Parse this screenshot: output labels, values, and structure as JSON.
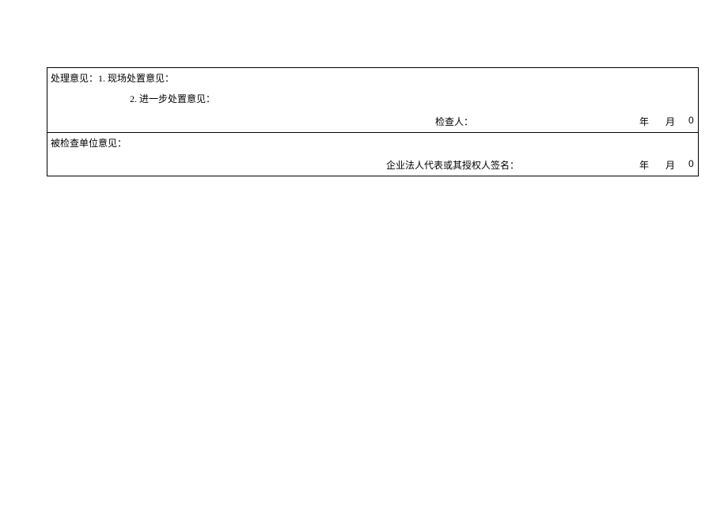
{
  "section1": {
    "header": "处理意见：1. 现场处置意见：",
    "item2": "2. 进一步处置意见：",
    "inspector": "检查人：",
    "year": "年",
    "month": "月",
    "zero": "0"
  },
  "section2": {
    "header": "被检查单位意见：",
    "rep": "企业法人代表或其授权人签名：",
    "year": "年",
    "month": "月",
    "zero": "0"
  }
}
